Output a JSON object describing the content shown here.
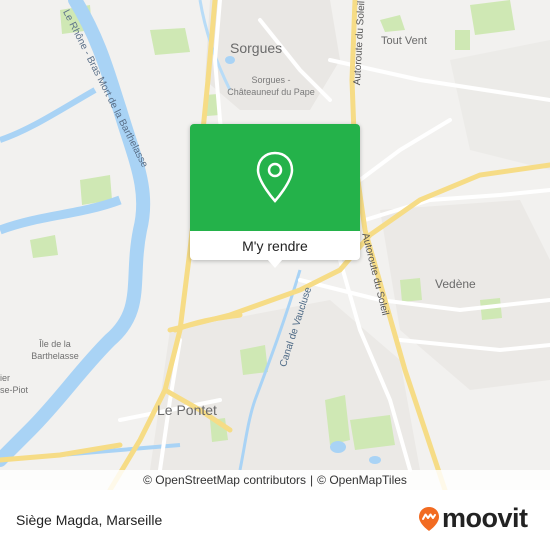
{
  "map": {
    "labels": {
      "sorgues": "Sorgues",
      "station": "Sorgues - Châteauneuf du Pape",
      "tout_vent": "Tout Vent",
      "vedene": "Vedène",
      "le_pontet": "Le Pontet",
      "ile": "Île de la Barthelasse",
      "ier": "ier",
      "se_piot": "se-Piot",
      "river": "Le Rhône - Bras Mort de la Barthelasse",
      "motorway_1": "Autoroute du Soleil",
      "motorway_2": "Autoroute du Soleil",
      "canal": "Canal de Vaucluse"
    },
    "colors": {
      "water": "#a9d3f5",
      "park": "#cfe8b4",
      "motorway": "#f6dc86",
      "road": "#ffffff",
      "land": "#f2f1ef",
      "urban": "#e9e7e4"
    }
  },
  "popup": {
    "icon": "location-pin-icon",
    "action_label": "M'y rendre",
    "color": "#24b24a"
  },
  "attribution": {
    "osm": "© OpenStreetMap contributors",
    "separator": "|",
    "tiles": "© OpenMapTiles"
  },
  "footer": {
    "place": "Siège Magda, Marseille",
    "brand": "moovit",
    "brand_color": "#f26b21"
  }
}
